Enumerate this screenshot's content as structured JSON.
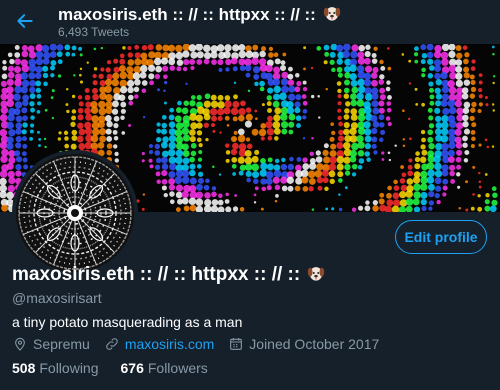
{
  "header": {
    "title": "maxosiris.eth :: // :: httpxx :: // ::",
    "tweet_count": "6,493 Tweets"
  },
  "profile": {
    "display_name": "maxosiris.eth :: // :: httpxx :: // ::",
    "emoji": "dog-face-icon",
    "handle": "@maxosirisart",
    "bio": "a tiny potato masquerading as a man",
    "location": "Sepremu",
    "website": "maxosiris.com",
    "joined": "Joined October 2017",
    "following_count": "508",
    "following_label": "Following",
    "followers_count": "676",
    "followers_label": "Followers"
  },
  "actions": {
    "edit_profile": "Edit profile"
  },
  "colors": {
    "background": "#15202b",
    "accent": "#1da1f2",
    "muted": "#8899a6"
  }
}
